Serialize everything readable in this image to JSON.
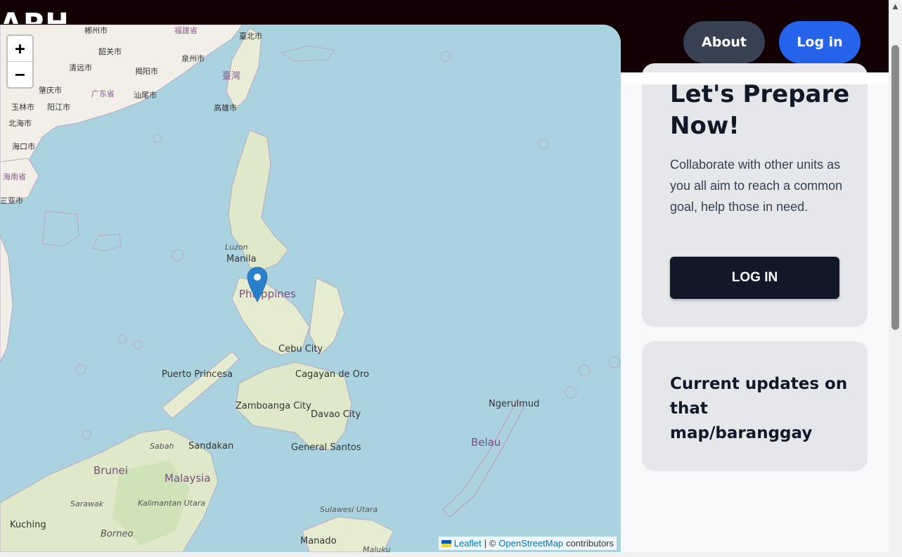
{
  "nav": {
    "brand": "APH",
    "about_label": "About",
    "login_label": "Log in"
  },
  "map": {
    "zoom_in": "+",
    "zoom_out": "−",
    "attribution": {
      "leaflet": "Leaflet",
      "separator": "| ©",
      "osm": "OpenStreetMap",
      "contributors": "contributors"
    },
    "labels": [
      "郴州市",
      "福建省",
      "臺北市",
      "韶关市",
      "泉州市",
      "清远市",
      "揭阳市",
      "臺灣",
      "肇庆市",
      "广东省",
      "汕尾市",
      "高雄市",
      "玉林市",
      "阳江市",
      "北海市",
      "海口市",
      "海南省",
      "三亚市",
      "Luzon",
      "Manila",
      "Philippines",
      "Cebu City",
      "Puerto Princesa",
      "Cagayan de Oro",
      "Zamboanga City",
      "Davao City",
      "Ngerulmud",
      "Sabah",
      "Sandakan",
      "General Santos",
      "Belau",
      "Brunei",
      "Malaysia",
      "Sarawak",
      "Kalimantan Utara",
      "Sulawesi Utara",
      "Kuching",
      "Borneo",
      "Manado",
      "Maluku"
    ],
    "marker": "map-pin-icon",
    "colors": {
      "water": "#aad3df",
      "land": "#f2efe9",
      "forest": "#c8dfb0",
      "marker": "#2a81cb"
    }
  },
  "cards": {
    "prepare": {
      "title": "Let's Prepare Now!",
      "text": "Collaborate with other units as you all aim to reach a common goal, help those in need.",
      "button": "LOG IN"
    },
    "updates": {
      "title": "Current updates on that map/baranggay"
    }
  },
  "colors": {
    "nav_bg": "#120004",
    "about_btn": "#374151",
    "login_btn": "#2563eb",
    "card_bg": "#e5e7eb",
    "dark_btn": "#111827"
  }
}
